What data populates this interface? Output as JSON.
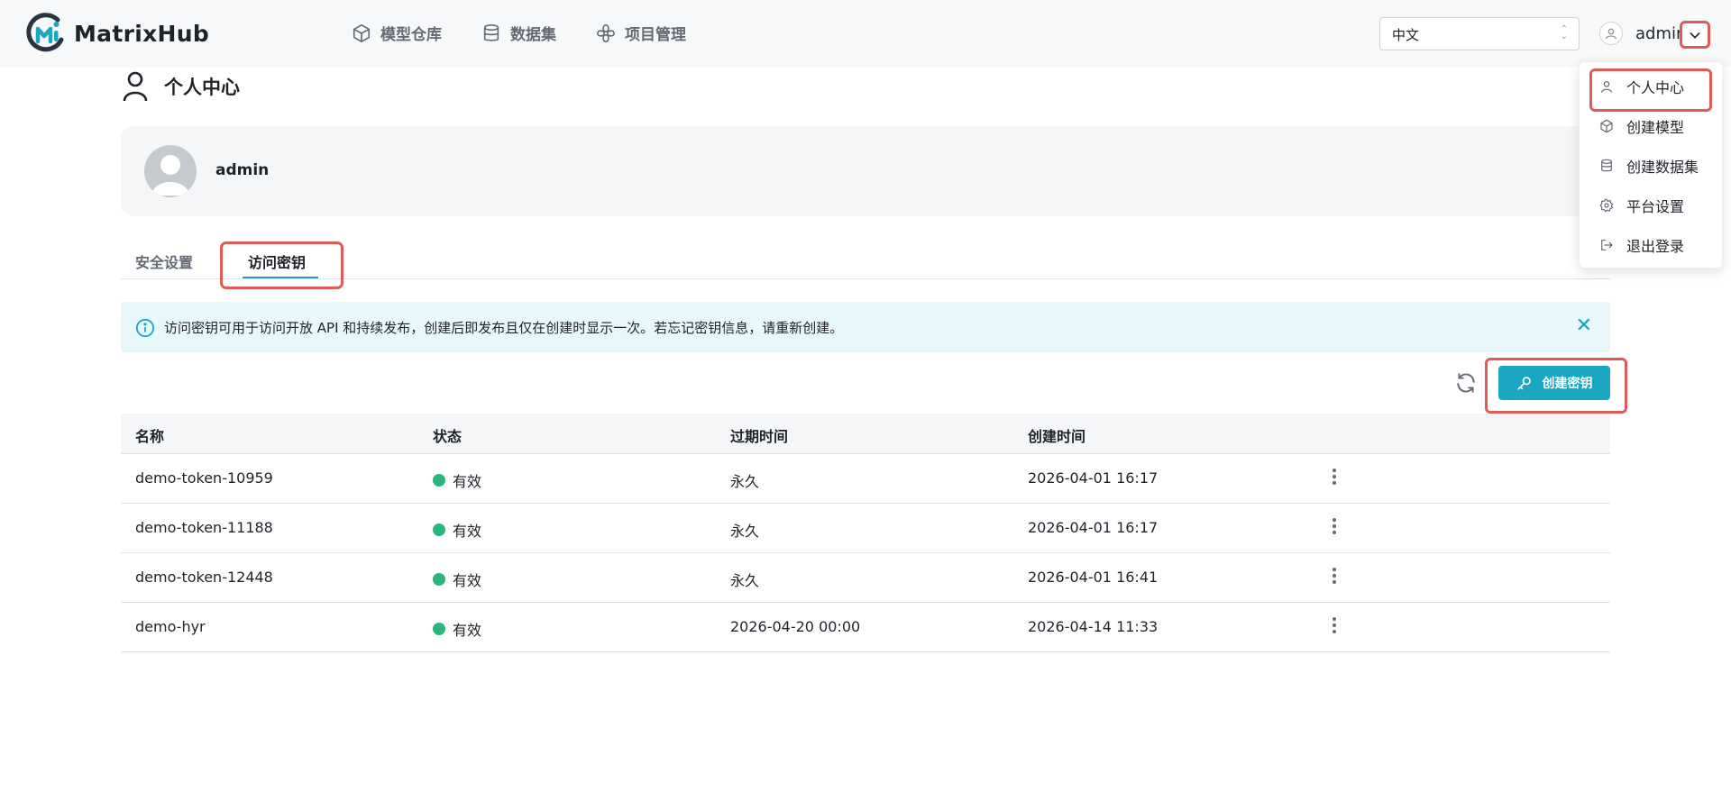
{
  "app": {
    "name": "MatrixHub"
  },
  "nav": {
    "items": [
      {
        "label": "模型仓库",
        "icon": "cube-icon"
      },
      {
        "label": "数据集",
        "icon": "database-icon"
      },
      {
        "label": "项目管理",
        "icon": "project-icon"
      }
    ]
  },
  "header": {
    "language": "中文",
    "username": "admin"
  },
  "page": {
    "title": "个人中心"
  },
  "profile": {
    "name": "admin"
  },
  "tabs": [
    {
      "label": "安全设置",
      "active": false
    },
    {
      "label": "访问密钥",
      "active": true
    }
  ],
  "alert": {
    "text": "访问密钥可用于访问开放 API 和持续发布，创建后即发布且仅在创建时显示一次。若忘记密钥信息，请重新创建。"
  },
  "toolbar": {
    "create_label": "创建密钥"
  },
  "table": {
    "columns": [
      "名称",
      "状态",
      "过期时间",
      "创建时间"
    ],
    "rows": [
      {
        "name": "demo-token-10959",
        "status": "有效",
        "expires": "永久",
        "created": "2026-04-01 16:17"
      },
      {
        "name": "demo-token-11188",
        "status": "有效",
        "expires": "永久",
        "created": "2026-04-01 16:17"
      },
      {
        "name": "demo-token-12448",
        "status": "有效",
        "expires": "永久",
        "created": "2026-04-01 16:41"
      },
      {
        "name": "demo-hyr",
        "status": "有效",
        "expires": "2026-04-20 00:00",
        "created": "2026-04-14 11:33"
      }
    ]
  },
  "user_menu": {
    "items": [
      {
        "label": "个人中心",
        "icon": "user-icon"
      },
      {
        "label": "创建模型",
        "icon": "cube-icon"
      },
      {
        "label": "创建数据集",
        "icon": "database-icon"
      },
      {
        "label": "平台设置",
        "icon": "gear-icon"
      },
      {
        "label": "退出登录",
        "icon": "logout-icon"
      }
    ]
  },
  "colors": {
    "accent": "#1aa7c4",
    "highlight": "#e05a5a",
    "status_valid": "#2bb57d"
  }
}
